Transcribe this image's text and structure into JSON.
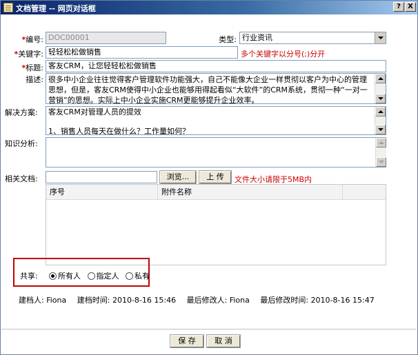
{
  "window": {
    "title": "文档管理 -- 网页对话框",
    "help_label": "?",
    "close_label": "X"
  },
  "form": {
    "number": {
      "label": "编号:",
      "value": "DOC00001"
    },
    "type": {
      "label": "类型:",
      "value": "行业资讯"
    },
    "keywords": {
      "label": "关键字:",
      "value": "轻轻松松做销售",
      "hint": "多个关键字以分号(;)分开"
    },
    "title": {
      "label": "标题:",
      "value": "客友CRM，让您轻轻松松做销售"
    },
    "description": {
      "label": "描述:",
      "value": "很多中小企业往往觉得客户管理软件功能强大，自己不能像大企业一样贯彻以客户为中心的管理思想，但是，客友CRM使得中小企业也能够用得起看似“大软件”的CRM系统，贯彻一种“一对一营销”的思想。实际上中小企业实施CRM更能够提升企业效率。"
    },
    "solution": {
      "label": "解决方案:",
      "line1": "客友CRM对管理人员的提效",
      "line2": "1、销售人员每天在做什么？工作量如何？"
    },
    "knowledge": {
      "label": "知识分析:",
      "value": ""
    },
    "attachment": {
      "label": "相关文档:",
      "browse_label": "浏览...",
      "upload_label": "上 传",
      "hint": "文件大小请限于5MB内",
      "columns": [
        "序号",
        "附件名称"
      ]
    },
    "share": {
      "label": "共享:",
      "options": [
        {
          "label": "所有人",
          "checked": true
        },
        {
          "label": "指定人",
          "checked": false
        },
        {
          "label": "私有",
          "checked": false
        }
      ]
    },
    "meta": {
      "creator_label": "建档人:",
      "creator": "Fiona",
      "created_label": "建档时间:",
      "created": "2010-8-16 15:46",
      "modifier_label": "最后修改人:",
      "modifier": "Fiona",
      "modified_label": "最后修改时间:",
      "modified": "2010-8-16 15:47"
    }
  },
  "footer": {
    "save_label": "保 存",
    "cancel_label": "取 消"
  },
  "required_mark": "*"
}
